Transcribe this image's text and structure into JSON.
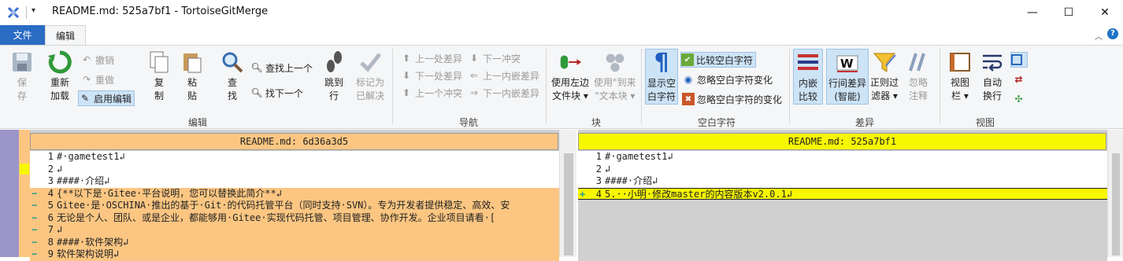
{
  "window": {
    "title": "README.md: 525a7bf1 - TortoiseGitMerge",
    "quick_access_dropdown": "▾",
    "min": "—",
    "max": "☐",
    "close": "✕"
  },
  "tabs": {
    "file": "文件",
    "edit": "编辑",
    "help": "?",
    "collapse": "︿"
  },
  "ribbon": {
    "edit": {
      "label": "编辑",
      "save": [
        "保",
        "存"
      ],
      "reload": [
        "重新",
        "加载"
      ],
      "undo": "撤销",
      "redo": "重做",
      "enable_edit": "启用编辑",
      "copy": [
        "复",
        "制"
      ],
      "paste": [
        "粘",
        "贴"
      ],
      "find": [
        "查",
        "找"
      ],
      "find_prev": "查找上一个",
      "find_next": "找下一个",
      "goto": [
        "跳到",
        "行"
      ],
      "mark_resolved": [
        "标记为",
        "已解决"
      ]
    },
    "nav": {
      "label": "导航",
      "prev_diff": "上一处差异",
      "next_diff": "下一处差异",
      "prev_conflict": "上一个冲突",
      "next_conflict": "下一冲突",
      "prev_inline": "上一内嵌差异",
      "next_inline": "下一内嵌差异"
    },
    "block": {
      "label": "块",
      "use_left": [
        "使用左边",
        "文件块 ▾"
      ],
      "use_theirs": [
        "使用\"到来",
        "\"文本块 ▾"
      ]
    },
    "whitespace": {
      "label": "空白字符",
      "show": [
        "显示空",
        "白字符"
      ],
      "compare": "比较空白字符",
      "ignore_changes": "忽略空白字符变化",
      "ignore_all": "忽略空白字符的变化"
    },
    "diff": {
      "label": "差异",
      "inline": [
        "内嵌",
        "比较"
      ],
      "line_diff": [
        "行间差异",
        "(智能)"
      ],
      "regex": [
        "正则过",
        "滤器 ▾"
      ],
      "ignore_comments": [
        "忽略",
        "注释"
      ]
    },
    "view": {
      "label": "视图",
      "viewbar": [
        "视图",
        "栏 ▾"
      ],
      "wrap": [
        "自动",
        "换行"
      ]
    }
  },
  "left": {
    "header": "README.md: 6d36a3d5",
    "lines": [
      {
        "n": "1",
        "mark": "",
        "text": "#·gametest1↲",
        "state": "normal"
      },
      {
        "n": "2",
        "mark": "",
        "text": "↲",
        "state": "normal"
      },
      {
        "n": "3",
        "mark": "",
        "text": "####·介绍↲",
        "state": "normal"
      },
      {
        "n": "4",
        "mark": "−",
        "text": "{**以下是·Gitee·平台说明，您可以替换此简介**↲",
        "state": "removed"
      },
      {
        "n": "5",
        "mark": "−",
        "text": "Gitee·是·OSCHINA·推出的基于·Git·的代码托管平台（同时支持·SVN）。专为开发者提供稳定、高效、安",
        "state": "removed"
      },
      {
        "n": "6",
        "mark": "−",
        "text": "无论是个人、团队、或是企业，都能够用·Gitee·实现代码托管、项目管理、协作开发。企业项目请看·[",
        "state": "removed"
      },
      {
        "n": "7",
        "mark": "−",
        "text": "↲",
        "state": "removed"
      },
      {
        "n": "8",
        "mark": "−",
        "text": "####·软件架构↲",
        "state": "removed"
      },
      {
        "n": "9",
        "mark": "−",
        "text": "软件架构说明↲",
        "state": "removed"
      }
    ]
  },
  "right": {
    "header": "README.md: 525a7bf1",
    "lines": [
      {
        "n": "1",
        "mark": "",
        "text": "#·gametest1↲",
        "state": "normal"
      },
      {
        "n": "2",
        "mark": "",
        "text": "↲",
        "state": "normal"
      },
      {
        "n": "3",
        "mark": "",
        "text": "####·介绍↲",
        "state": "normal"
      },
      {
        "n": "4",
        "mark": "+",
        "text": "5.··小明·修改master的内容版本v2.0.1↲",
        "state": "added"
      },
      {
        "n": "",
        "mark": "",
        "text": "",
        "state": "filler"
      },
      {
        "n": "",
        "mark": "",
        "text": "",
        "state": "filler"
      },
      {
        "n": "",
        "mark": "",
        "text": "",
        "state": "filler"
      },
      {
        "n": "",
        "mark": "",
        "text": "",
        "state": "filler"
      },
      {
        "n": "",
        "mark": "",
        "text": "",
        "state": "filler"
      }
    ]
  },
  "colors": {
    "removed": "#fcc682",
    "added": "#f7f700",
    "filler": "#d0d0d0",
    "accent": "#2b6cc4"
  }
}
